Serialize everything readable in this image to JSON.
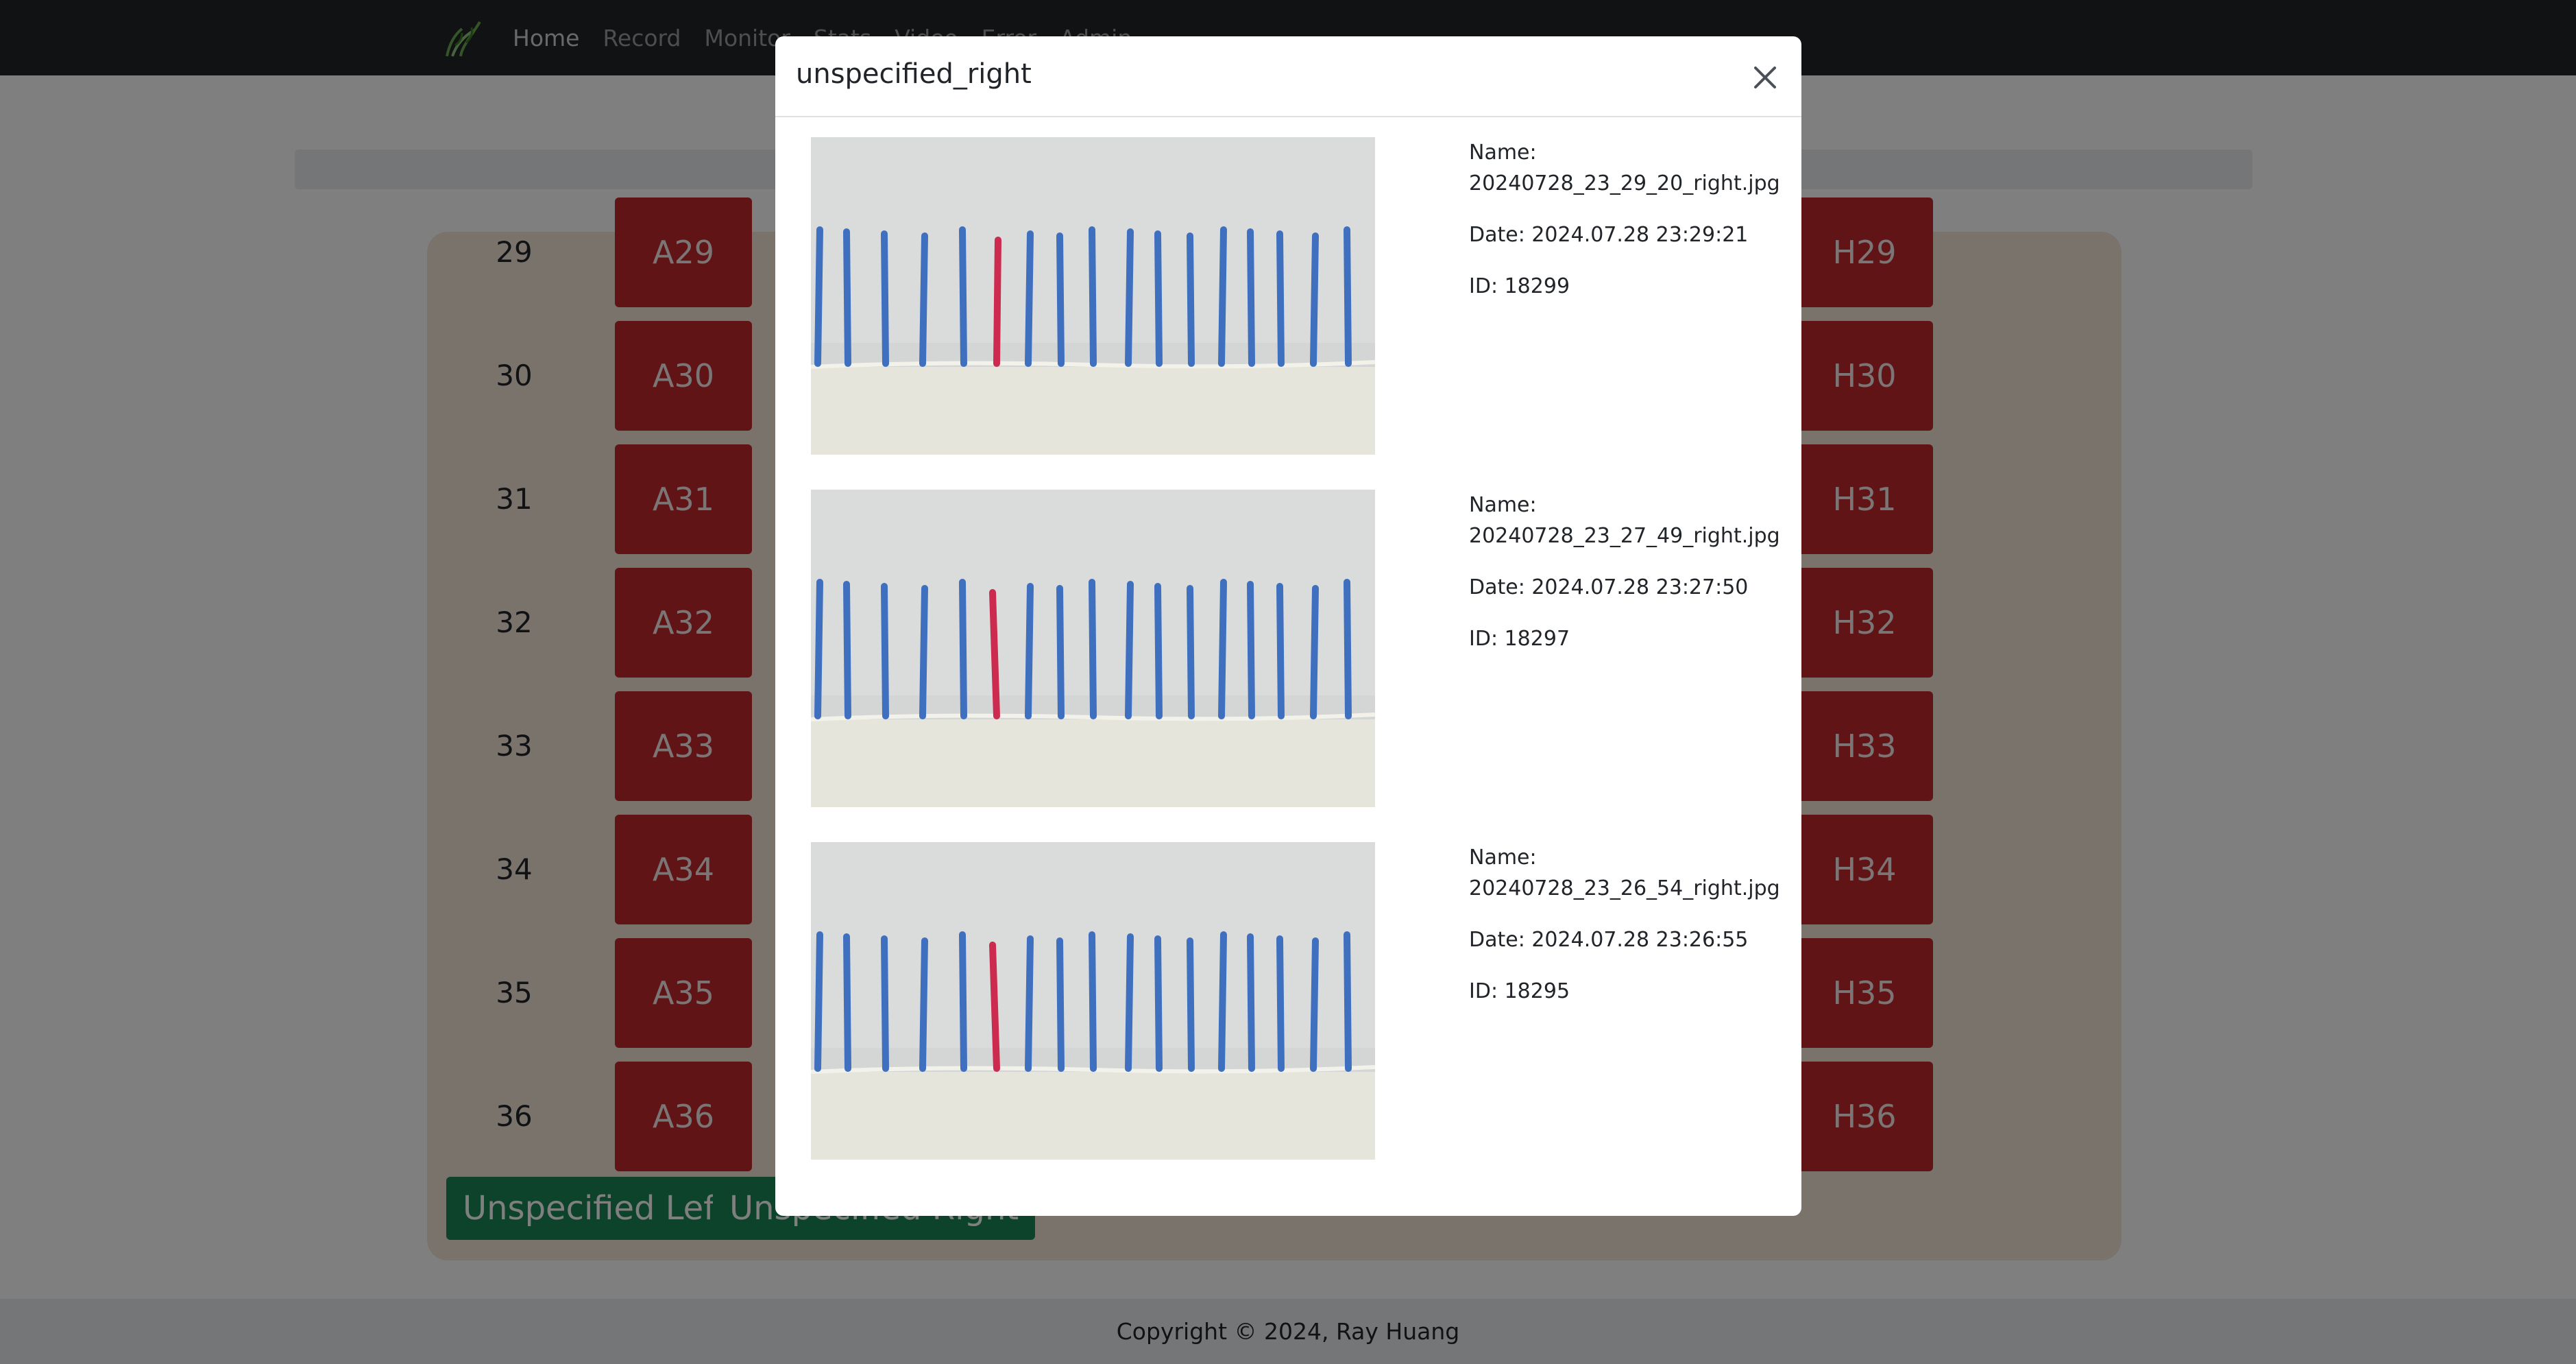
{
  "navbar": {
    "logo_icon": "grass-sprout-icon",
    "links": [
      "Home",
      "Record",
      "Monitor",
      "Stats",
      "Video",
      "Error",
      "Admin"
    ]
  },
  "grid": {
    "rows": [
      {
        "num": "29",
        "a": "A29",
        "h": "H29"
      },
      {
        "num": "30",
        "a": "A30",
        "h": "H30"
      },
      {
        "num": "31",
        "a": "A31",
        "h": "H31"
      },
      {
        "num": "32",
        "a": "A32",
        "h": "H32"
      },
      {
        "num": "33",
        "a": "A33",
        "h": "H33"
      },
      {
        "num": "34",
        "a": "A34",
        "h": "H34"
      },
      {
        "num": "35",
        "a": "A35",
        "h": "H35"
      },
      {
        "num": "36",
        "a": "A36",
        "h": "H36"
      }
    ],
    "unspecified_left": "Unspecified Left",
    "unspecified_right": "Unspecified Right"
  },
  "footer": {
    "copyright": "Copyright © 2024, Ray Huang"
  },
  "modal": {
    "title": "unspecified_right",
    "close_icon": "close-icon",
    "items": [
      {
        "name_label": "Name:",
        "name": "20240728_23_29_20_right.jpg",
        "date": "Date: 2024.07.28 23:29:21",
        "id": "ID: 18299"
      },
      {
        "name_label": "Name:",
        "name": "20240728_23_27_49_right.jpg",
        "date": "Date: 2024.07.28 23:27:50",
        "id": "ID: 18297"
      },
      {
        "name_label": "Name:",
        "name": "20240728_23_26_54_right.jpg",
        "date": "Date: 2024.07.28 23:26:55",
        "id": "ID: 18295"
      }
    ]
  },
  "colors": {
    "seat": "#c0282d",
    "success": "#198754",
    "stick_blue": "#3f6fbf",
    "stick_red": "#cc2a4e"
  }
}
